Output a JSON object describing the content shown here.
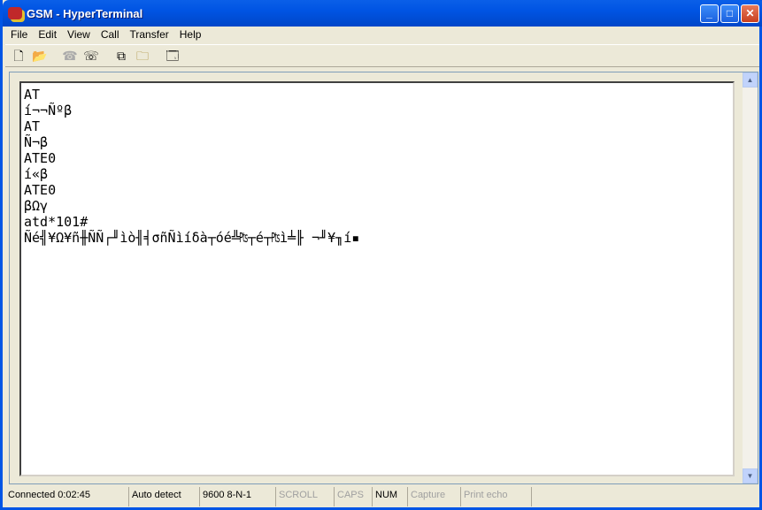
{
  "window": {
    "title": "GSM - HyperTerminal",
    "minimize": "_",
    "maximize": "□",
    "close": "✕"
  },
  "menu": [
    "File",
    "Edit",
    "View",
    "Call",
    "Transfer",
    "Help"
  ],
  "toolbar": [
    {
      "icon": "new-icon",
      "glyph": "🗋"
    },
    {
      "icon": "open-icon",
      "glyph": "📂"
    },
    {
      "icon": "disconnect-phone-icon",
      "glyph": "☎"
    },
    {
      "icon": "dial-icon",
      "glyph": "☏"
    },
    {
      "icon": "send-icon",
      "glyph": "⧉"
    },
    {
      "icon": "receive-icon",
      "glyph": "🗀"
    },
    {
      "icon": "properties-icon",
      "glyph": "🗔"
    }
  ],
  "terminal": {
    "lines": [
      "AT",
      "í¬¬Ñºβ",
      "AT",
      "Ñ¬β",
      "ATE0",
      "í«β",
      "ATE0",
      "βΩγ",
      "atd*101#",
      "Ñé╣¥Ω¥ñ╫ÑÑ┌╜ìò╢╡σñÑìíδà┬óé╩₧┬é┬₧ì╧╟ ¬╜¥╖í▪"
    ]
  },
  "status": {
    "connected": "Connected 0:02:45",
    "detect": "Auto detect",
    "settings": "9600 8-N-1",
    "scroll": "SCROLL",
    "caps": "CAPS",
    "num": "NUM",
    "capture": "Capture",
    "print_echo": "Print echo"
  }
}
